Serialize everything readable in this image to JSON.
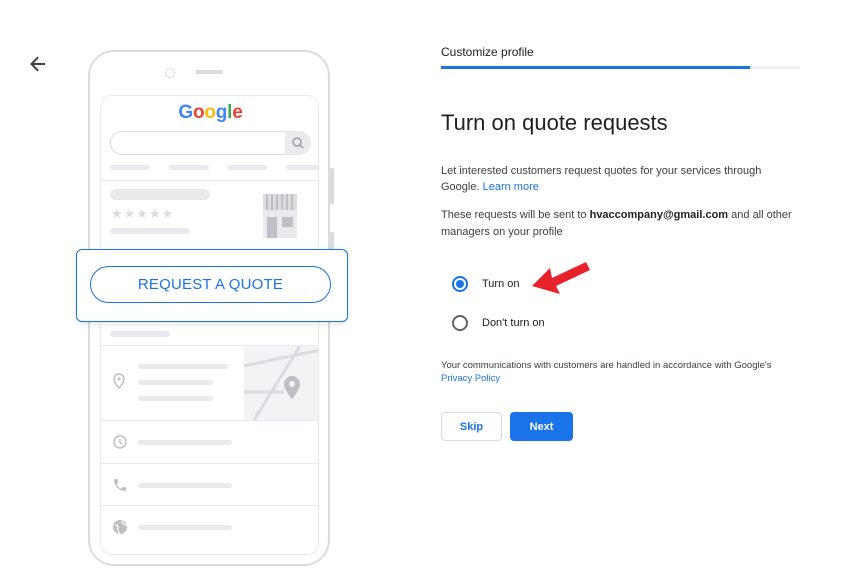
{
  "header": {
    "step_label": "Customize profile",
    "progress": 0.86
  },
  "main": {
    "title": "Turn on quote requests",
    "description1": "Let interested customers request quotes for your services through Google.",
    "learn_more": "Learn more",
    "description2_prefix": "These requests will be sent to",
    "email": "hvaccompany@gmail.com",
    "description2_suffix": "and all other managers on your profile",
    "options": [
      {
        "label": "Turn on",
        "selected": true
      },
      {
        "label": "Don't turn on",
        "selected": false
      }
    ],
    "notice": "Your communications with customers are handled in accordance with Google's",
    "privacy_policy": "Privacy Policy",
    "skip_label": "Skip",
    "next_label": "Next"
  },
  "illustration": {
    "logo_letters": [
      "G",
      "o",
      "o",
      "g",
      "l",
      "e"
    ],
    "request_quote_label": "REQUEST A QUOTE"
  },
  "colors": {
    "accent": "#1a73e8",
    "annotation_arrow": "#e8222a"
  },
  "icons": [
    "back-arrow-icon",
    "search-icon",
    "storefront-icon",
    "location-pin-icon",
    "clock-icon",
    "phone-icon",
    "globe-icon",
    "map-pin-icon"
  ]
}
